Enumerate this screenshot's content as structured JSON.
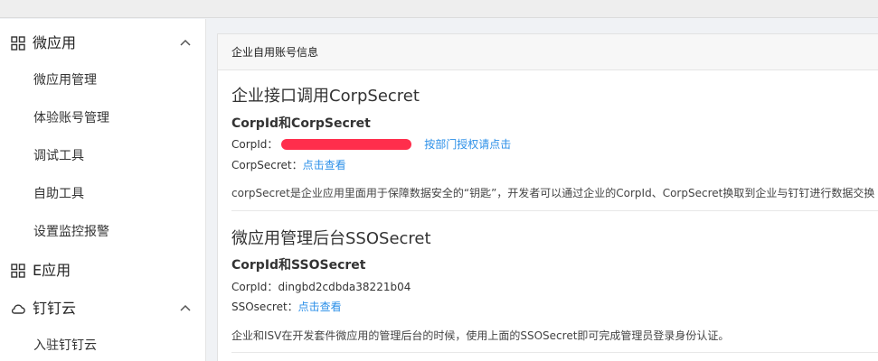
{
  "sidebar": {
    "groups": [
      {
        "label": "微应用",
        "expanded": true,
        "items": [
          "微应用管理",
          "体验账号管理",
          "调试工具",
          "自助工具",
          "设置监控报警"
        ]
      },
      {
        "label": "E应用"
      },
      {
        "label": "钉钉云",
        "expanded": true,
        "items": [
          "入驻钉钉云"
        ]
      }
    ]
  },
  "card": {
    "header": "企业自用账号信息",
    "corp": {
      "title": "企业接口调用CorpSecret",
      "subtitle": "CorpId和CorpSecret",
      "corpid_label": "CorpId：",
      "dept_auth_link": "按部门授权请点击",
      "secret_label": "CorpSecret：",
      "view_link": "点击查看",
      "description": "corpSecret是企业应用里面用于保障数据安全的“钥匙”，开发者可以通过企业的CorpId、CorpSecret换取到企业与钉钉进行数据交换"
    },
    "sso": {
      "title": "微应用管理后台SSOSecret",
      "subtitle": "CorpId和SSOSecret",
      "corpid_label": "CorpId：",
      "corpid_value": "dingbd2cdbda38221b04",
      "secret_label": "SSOsecret：",
      "view_link": "点击查看",
      "description": "企业和ISV在开发套件微应用的管理后台的时候，使用上面的SSOSecret即可完成管理员登录身份认证。"
    }
  },
  "colors": {
    "link": "#2b8fe8",
    "redaction": "#ff2e4c"
  },
  "icons": [
    "grid-icon",
    "cloud-icon",
    "chevron-up-icon"
  ]
}
